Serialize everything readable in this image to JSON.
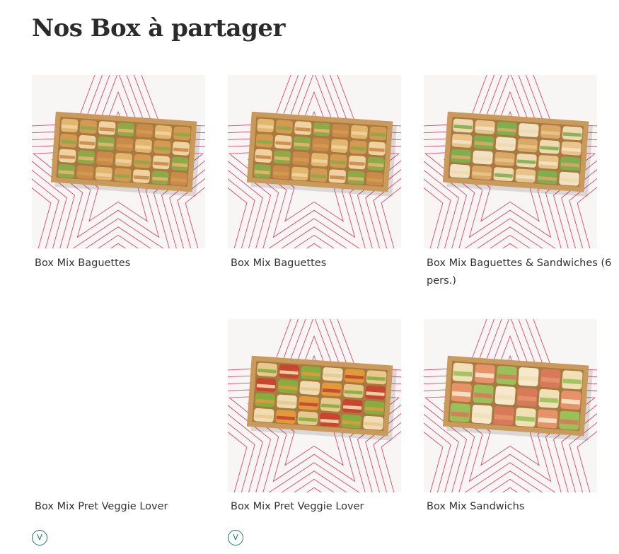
{
  "page": {
    "title": "Nos Box à partager"
  },
  "products": [
    {
      "name": "Box Mix Baguettes",
      "has_image": true,
      "fill": "baguettes",
      "veggie": false
    },
    {
      "name": "Box Mix Baguettes",
      "has_image": true,
      "fill": "baguettes",
      "veggie": false
    },
    {
      "name": "Box Mix Baguettes & Sandwiches (6 pers.)",
      "has_image": true,
      "fill": "mixed",
      "veggie": false
    },
    {
      "name": "Box Mix Pret Veggie Lover",
      "has_image": false,
      "fill": "none",
      "veggie": true,
      "badge": "V"
    },
    {
      "name": "Box Mix Pret Veggie Lover",
      "has_image": true,
      "fill": "veggie",
      "veggie": true,
      "badge": "V"
    },
    {
      "name": "Box Mix Sandwichs",
      "has_image": true,
      "fill": "sandwiches",
      "veggie": false
    }
  ],
  "colors": {
    "title": "#2b2b2b",
    "text": "#333333",
    "pattern_line": "#d9285a",
    "image_bg": "#f7f6f4",
    "box_kraft": "#c99a5b",
    "veggie_badge": "#1d7a5f"
  },
  "icons": {
    "veggie_badge": "veggie-v-icon"
  }
}
